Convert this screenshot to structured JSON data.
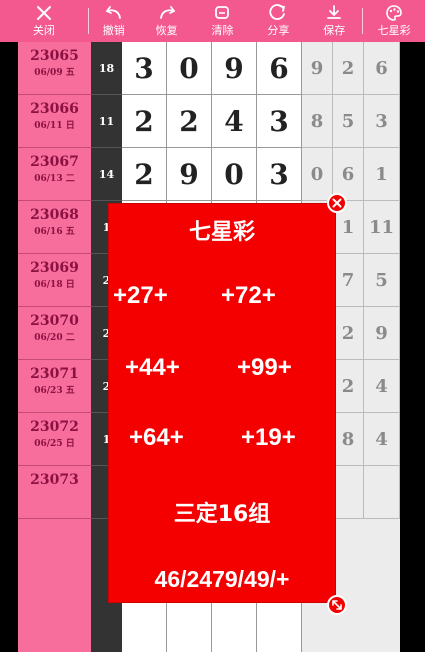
{
  "toolbar": {
    "close_label": "关闭",
    "undo_label": "撤销",
    "redo_label": "恢复",
    "clear_label": "清除",
    "share_label": "分享",
    "save_label": "保存",
    "game_label": "七星彩"
  },
  "rows": [
    {
      "issue": "23065",
      "date": "06/09 五",
      "sum": "18",
      "nums": [
        "3",
        "0",
        "9",
        "6"
      ],
      "ext": [
        "9",
        "2",
        "6"
      ]
    },
    {
      "issue": "23066",
      "date": "06/11 日",
      "sum": "11",
      "nums": [
        "2",
        "2",
        "4",
        "3"
      ],
      "ext": [
        "8",
        "5",
        "3"
      ]
    },
    {
      "issue": "23067",
      "date": "06/13 二",
      "sum": "14",
      "nums": [
        "2",
        "9",
        "0",
        "3"
      ],
      "ext": [
        "0",
        "6",
        "1"
      ]
    },
    {
      "issue": "23068",
      "date": "06/16 五",
      "sum": "1",
      "nums": [
        "",
        "",
        "",
        ""
      ],
      "ext": [
        "",
        "1",
        "11"
      ]
    },
    {
      "issue": "23069",
      "date": "06/18 日",
      "sum": "2",
      "nums": [
        "",
        "",
        "",
        ""
      ],
      "ext": [
        "",
        "7",
        "5"
      ]
    },
    {
      "issue": "23070",
      "date": "06/20 二",
      "sum": "2",
      "nums": [
        "",
        "",
        "",
        ""
      ],
      "ext": [
        "",
        "2",
        "9"
      ]
    },
    {
      "issue": "23071",
      "date": "06/23 五",
      "sum": "2",
      "nums": [
        "",
        "",
        "",
        ""
      ],
      "ext": [
        "",
        "2",
        "4"
      ]
    },
    {
      "issue": "23072",
      "date": "06/25 日",
      "sum": "1",
      "nums": [
        "",
        "",
        "",
        ""
      ],
      "ext": [
        "",
        "8",
        "4"
      ]
    },
    {
      "issue": "23073",
      "date": "",
      "sum": "",
      "nums": [
        "",
        "",
        "",
        ""
      ],
      "ext": [
        "",
        "",
        ""
      ]
    }
  ],
  "overlay": {
    "title": "七星彩",
    "picks": [
      "+27+",
      "+72+",
      "+44+",
      "+99+",
      "+64+",
      "+19+"
    ],
    "combo": "三定16组",
    "footer": "46/2479/49/+"
  }
}
